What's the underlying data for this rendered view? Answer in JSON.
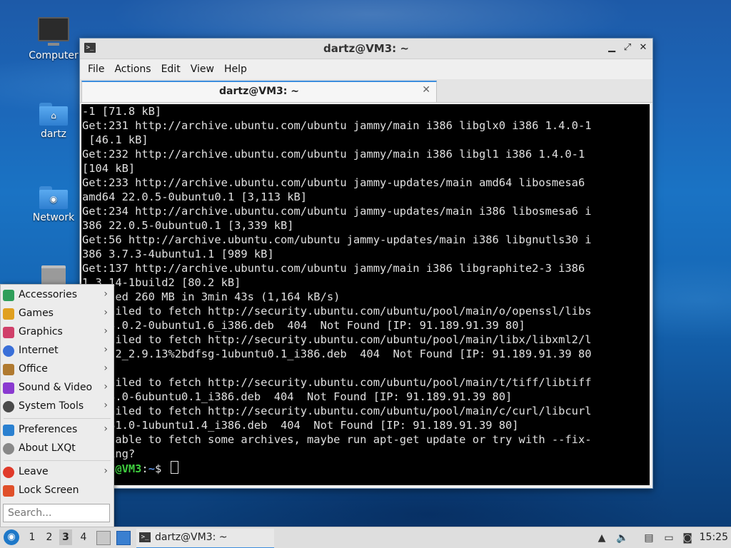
{
  "desktop": {
    "icons": [
      {
        "label": "Computer"
      },
      {
        "label": "dartz"
      },
      {
        "label": "Network"
      }
    ]
  },
  "window": {
    "title": "dartz@VM3: ~",
    "controls": {
      "minimize": "▁",
      "maximize": "⤢",
      "close": "✕"
    },
    "menu": [
      "File",
      "Actions",
      "Edit",
      "View",
      "Help"
    ],
    "tab": {
      "label": "dartz@VM3: ~",
      "close": "✕"
    }
  },
  "terminal": {
    "lines": [
      "-1 [71.8 kB]",
      "Get:231 http://archive.ubuntu.com/ubuntu jammy/main i386 libglx0 i386 1.4.0-1",
      " [46.1 kB]",
      "Get:232 http://archive.ubuntu.com/ubuntu jammy/main i386 libgl1 i386 1.4.0-1",
      "[104 kB]",
      "Get:233 http://archive.ubuntu.com/ubuntu jammy-updates/main amd64 libosmesa6",
      "amd64 22.0.5-0ubuntu0.1 [3,113 kB]",
      "Get:234 http://archive.ubuntu.com/ubuntu jammy-updates/main i386 libosmesa6 i",
      "386 22.0.5-0ubuntu0.1 [3,339 kB]",
      "Get:56 http://archive.ubuntu.com/ubuntu jammy-updates/main i386 libgnutls30 i",
      "386 3.7.3-4ubuntu1.1 [989 kB]",
      "Get:137 http://archive.ubuntu.com/ubuntu jammy/main i386 libgraphite2-3 i386",
      "1.3.14-1build2 [80.2 kB]",
      "Fetched 260 MB in 3min 43s (1,164 kB/s)",
      "E: Failed to fetch http://security.ubuntu.com/ubuntu/pool/main/o/openssl/libs",
      "sl3_3.0.2-0ubuntu1.6_i386.deb  404  Not Found [IP: 91.189.91.39 80]",
      "E: Failed to fetch http://security.ubuntu.com/ubuntu/pool/main/libx/libxml2/l",
      "ibxml2_2.9.13%2bdfsg-1ubuntu0.1_i386.deb  404  Not Found [IP: 91.189.91.39 80",
      "]",
      "E: Failed to fetch http://security.ubuntu.com/ubuntu/pool/main/t/tiff/libtiff",
      "5_4.3.0-6ubuntu0.1_i386.deb  404  Not Found [IP: 91.189.91.39 80]",
      "E: Failed to fetch http://security.ubuntu.com/ubuntu/pool/main/c/curl/libcurl",
      "4_7.81.0-1ubuntu1.4_i386.deb  404  Not Found [IP: 91.189.91.39 80]",
      "E: Unable to fetch some archives, maybe run apt-get update or try with --fix-",
      "missing?"
    ],
    "prompt_user": "dartz@VM3",
    "prompt_colon": ":",
    "prompt_path": "~",
    "prompt_symbol": "$ "
  },
  "start_menu": {
    "items": [
      {
        "label": "Accessories",
        "arrow": "›",
        "color": "#2f9e5a"
      },
      {
        "label": "Games",
        "arrow": "›",
        "color": "#e0a020"
      },
      {
        "label": "Graphics",
        "arrow": "›",
        "color": "#d0406a"
      },
      {
        "label": "Internet",
        "arrow": "›",
        "color": "#3a6fd8"
      },
      {
        "label": "Office",
        "arrow": "›",
        "color": "#b07a30"
      },
      {
        "label": "Sound & Video",
        "arrow": "›",
        "color": "#8a3ad0"
      },
      {
        "label": "System Tools",
        "arrow": "›",
        "color": "#4a4a4a"
      },
      {
        "label": "Preferences",
        "arrow": "›",
        "color": "#2a80d0"
      },
      {
        "label": "About LXQt",
        "arrow": "",
        "color": "#888888"
      },
      {
        "label": "Leave",
        "arrow": "›",
        "color": "#e03a2a"
      },
      {
        "label": "Lock Screen",
        "arrow": "",
        "color": "#e0502a"
      }
    ],
    "search_placeholder": "Search..."
  },
  "taskbar": {
    "desktops": [
      "1",
      "2",
      "3",
      "4"
    ],
    "active_desktop": "3",
    "task_label": "dartz@VM3: ~",
    "clock": "15:25"
  }
}
